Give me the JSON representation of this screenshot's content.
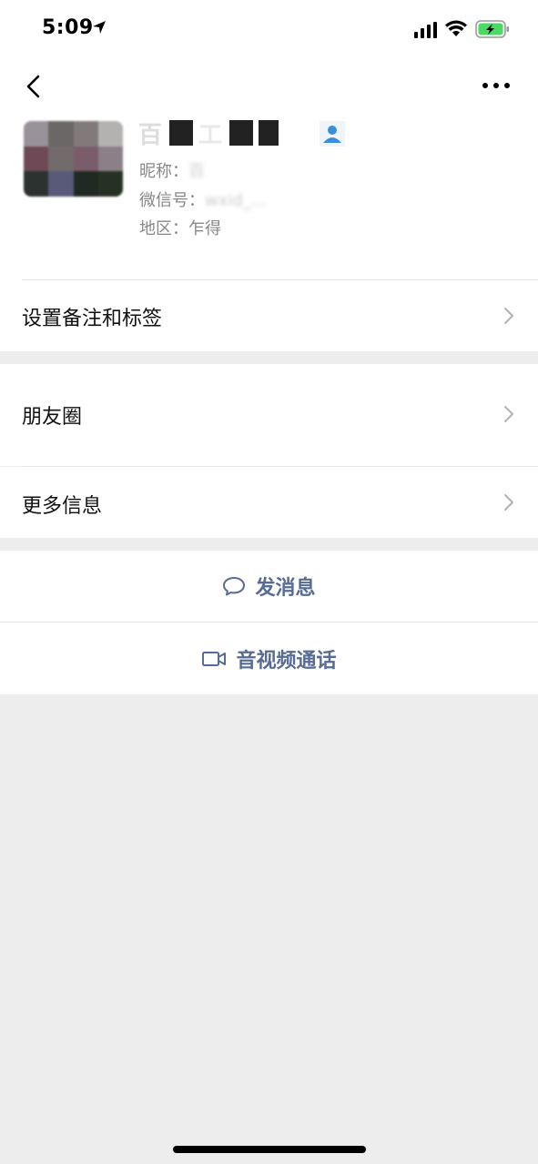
{
  "status_bar": {
    "time": "5:09"
  },
  "profile": {
    "name": "百",
    "nickname_label": "昵称：",
    "nickname_value": "百",
    "wechat_id_label": "微信号：",
    "wechat_id_value": "wxid_...",
    "region_label": "地区：",
    "region_value": "乍得"
  },
  "menu": {
    "remark_tags": "设置备注和标签",
    "moments": "朋友圈",
    "more_info": "更多信息"
  },
  "actions": {
    "send_message": "发消息",
    "video_call": "音视频通话"
  },
  "colors": {
    "link_blue": "#576b95",
    "background": "#ededed",
    "battery_green": "#4cd964"
  },
  "icons": {
    "back": "chevron-left-icon",
    "more": "ellipsis-icon",
    "chevron": "chevron-right-icon",
    "message": "chat-bubble-icon",
    "video": "video-camera-icon"
  }
}
